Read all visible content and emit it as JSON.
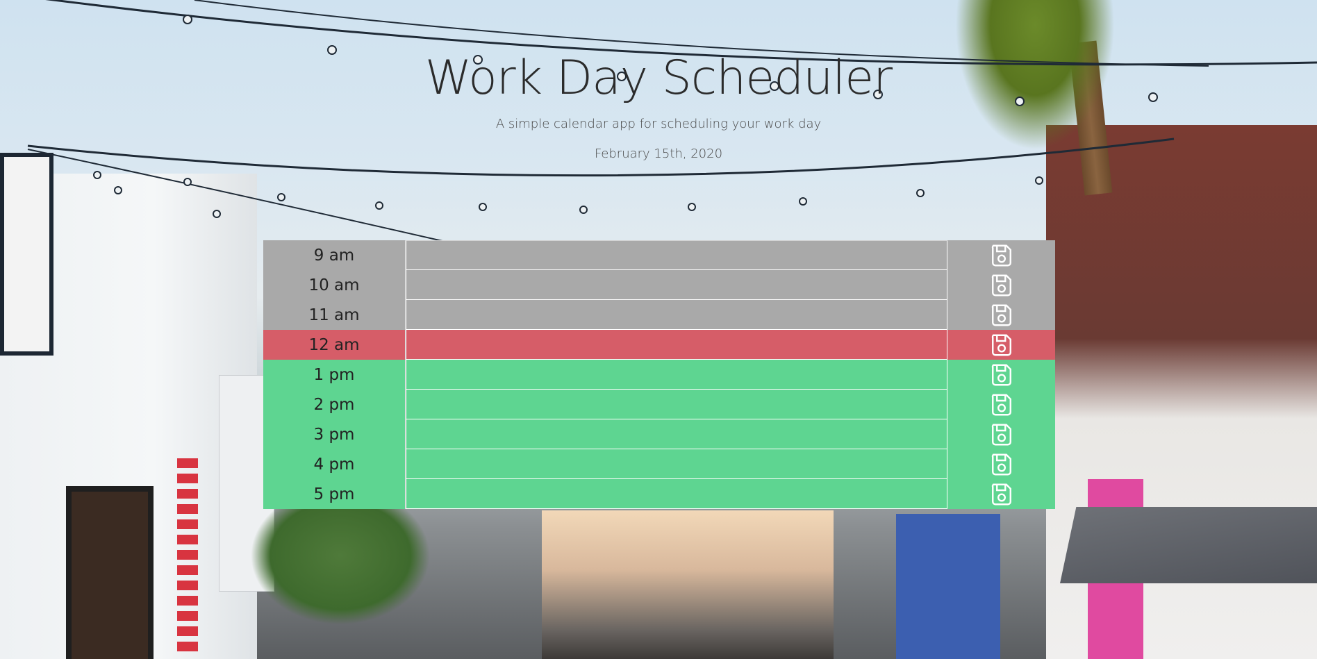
{
  "header": {
    "title": "Work Day Scheduler",
    "lead": "A simple calendar app for scheduling your work day",
    "current_day": "February 15th, 2020"
  },
  "schedule": {
    "rows": [
      {
        "hour": "9 am",
        "status": "past",
        "text": "",
        "color": "#a9a9a9"
      },
      {
        "hour": "10 am",
        "status": "past",
        "text": "",
        "color": "#a9a9a9"
      },
      {
        "hour": "11 am",
        "status": "past",
        "text": "",
        "color": "#a9a9a9"
      },
      {
        "hour": "12 am",
        "status": "present",
        "text": "",
        "color": "#d65d68"
      },
      {
        "hour": "1 pm",
        "status": "future",
        "text": "",
        "color": "#5ed591"
      },
      {
        "hour": "2 pm",
        "status": "future",
        "text": "",
        "color": "#5ed591"
      },
      {
        "hour": "3 pm",
        "status": "future",
        "text": "",
        "color": "#5ed591"
      },
      {
        "hour": "4 pm",
        "status": "future",
        "text": "",
        "color": "#5ed591"
      },
      {
        "hour": "5 pm",
        "status": "future",
        "text": "",
        "color": "#5ed591"
      }
    ],
    "save_icon": "floppy-disk-save-icon"
  },
  "colors": {
    "past": "#a9a9a9",
    "present": "#d65d68",
    "future": "#5ed591",
    "title_text": "#2b2b2b"
  }
}
